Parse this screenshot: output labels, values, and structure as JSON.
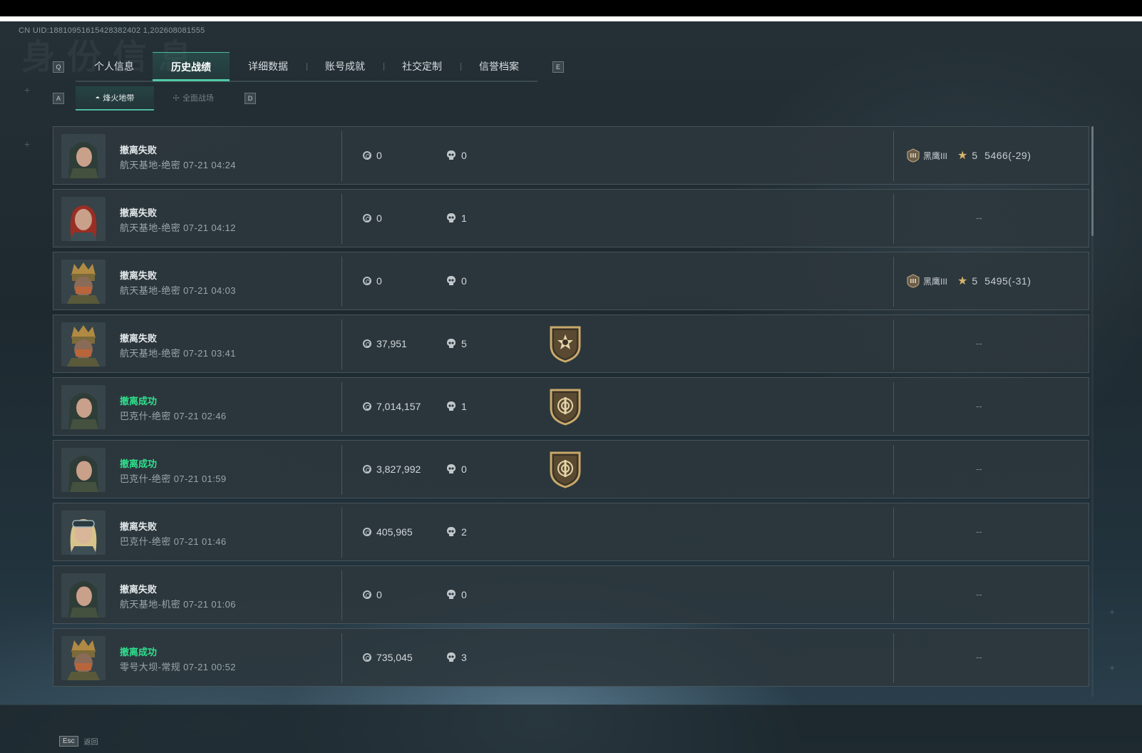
{
  "uid_text": "CN UID:18810951615428382402 1,202608081555",
  "watermark": "身份信息",
  "tabs_nav": {
    "prev_key": "Q",
    "next_key": "E"
  },
  "tabs": [
    {
      "label": "个人信息",
      "active": false
    },
    {
      "label": "历史战绩",
      "active": true
    },
    {
      "label": "详细数据",
      "active": false
    },
    {
      "label": "账号成就",
      "active": false
    },
    {
      "label": "社交定制",
      "active": false
    },
    {
      "label": "信誉档案",
      "active": false
    }
  ],
  "subtabs_nav": {
    "prev_key": "A",
    "next_key": "D"
  },
  "subtabs": [
    {
      "label": "烽火地带",
      "icon": "helmet-icon",
      "active": true
    },
    {
      "label": "全面战场",
      "icon": "crosshair-icon",
      "active": false
    }
  ],
  "matches": [
    {
      "status": "撤离失败",
      "success": false,
      "map_time": "航天基地-绝密 07-21 04:24",
      "value": "0",
      "kills": "0",
      "avatar": "female-hooded",
      "badge": null,
      "rank": {
        "tier": "黑鹰III",
        "stars": "5",
        "score": "5466(-29)"
      }
    },
    {
      "status": "撤离失败",
      "success": false,
      "map_time": "航天基地-绝密 07-21 04:12",
      "value": "0",
      "kills": "1",
      "avatar": "red-hair",
      "badge": null,
      "rank": null,
      "rank_placeholder": "--"
    },
    {
      "status": "撤离失败",
      "success": false,
      "map_time": "航天基地-绝密 07-21 04:03",
      "value": "0",
      "kills": "0",
      "avatar": "armored-helmet",
      "badge": null,
      "rank": {
        "tier": "黑鹰III",
        "stars": "5",
        "score": "5495(-31)"
      }
    },
    {
      "status": "撤离失败",
      "success": false,
      "map_time": "航天基地-绝密 07-21 03:41",
      "value": "37,951",
      "kills": "5",
      "avatar": "armored-helmet",
      "badge": "star-shield-badge",
      "rank": null,
      "rank_placeholder": "--"
    },
    {
      "status": "撤离成功",
      "success": true,
      "map_time": "巴克什-绝密 07-21 02:46",
      "value": "7,014,157",
      "kills": "1",
      "avatar": "female-hooded",
      "badge": "emblem-shield-badge",
      "rank": null,
      "rank_placeholder": "--"
    },
    {
      "status": "撤离成功",
      "success": true,
      "map_time": "巴克什-绝密 07-21 01:59",
      "value": "3,827,992",
      "kills": "0",
      "avatar": "female-hooded",
      "badge": "emblem-shield-badge",
      "rank": null,
      "rank_placeholder": "--"
    },
    {
      "status": "撤离失败",
      "success": false,
      "map_time": "巴克什-绝密 07-21 01:46",
      "value": "405,965",
      "kills": "2",
      "avatar": "blonde-goggles",
      "badge": null,
      "rank": null,
      "rank_placeholder": "--"
    },
    {
      "status": "撤离失败",
      "success": false,
      "map_time": "航天基地-机密 07-21 01:06",
      "value": "0",
      "kills": "0",
      "avatar": "female-hooded",
      "badge": null,
      "rank": null,
      "rank_placeholder": "--"
    },
    {
      "status": "撤离成功",
      "success": true,
      "map_time": "零号大坝-常规 07-21 00:52",
      "value": "735,045",
      "kills": "3",
      "avatar": "armored-helmet",
      "badge": null,
      "rank": null,
      "rank_placeholder": "--"
    }
  ],
  "footer": {
    "esc_key": "Esc",
    "back_label": "返回"
  },
  "colors": {
    "success": "#2fe08d",
    "accent": "#4fb89a",
    "row_bg": "#2c373d"
  }
}
